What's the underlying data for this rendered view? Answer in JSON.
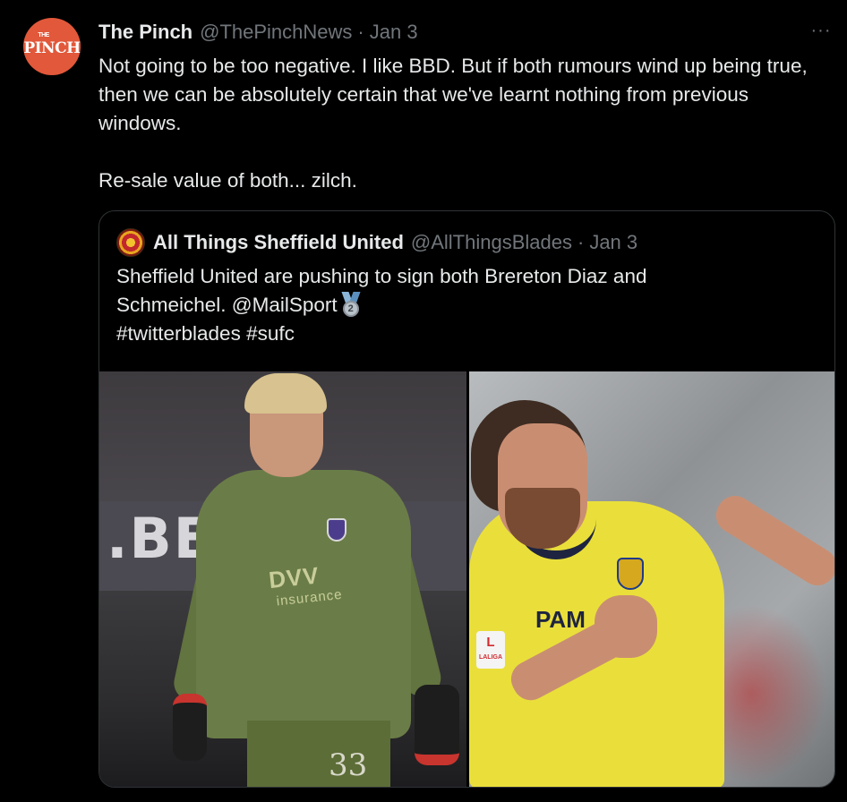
{
  "tweet": {
    "avatar_text": "PINCH",
    "avatar_small": "THE",
    "author_name": "The Pinch",
    "author_handle": "@ThePinchNews",
    "separator": "·",
    "date": "Jan 3",
    "more_label": "···",
    "text_paragraph_1": "Not going to be too negative. I like BBD. But if both rumours wind up being true, then we can be absolutely certain that we've learnt nothing from previous windows.",
    "text_paragraph_2": "Re-sale value of both... zilch."
  },
  "quote": {
    "author_name": "All Things Sheffield United",
    "author_handle": "@AllThingsBlades",
    "separator": "·",
    "date": "Jan 3",
    "text_line_1": "Sheffield United are pushing to sign both Brereton Diaz and",
    "text_line_2_prefix": "Schmeichel. @MailSport",
    "medal_number": "2",
    "hashtags": "#twitterblades #sufc",
    "media": {
      "left": {
        "banner_text": ".BE/",
        "sponsor": "DVV",
        "sponsor_sub": "insurance",
        "kit_number": "33"
      },
      "right": {
        "sponsor": "PAM",
        "laliga_mark": "L",
        "laliga_label": "LALIGA"
      }
    }
  },
  "colors": {
    "background": "#000000",
    "text_primary": "#e7e9ea",
    "text_secondary": "#71767b",
    "border": "#2f3336",
    "avatar_brand": "#e2583a"
  }
}
